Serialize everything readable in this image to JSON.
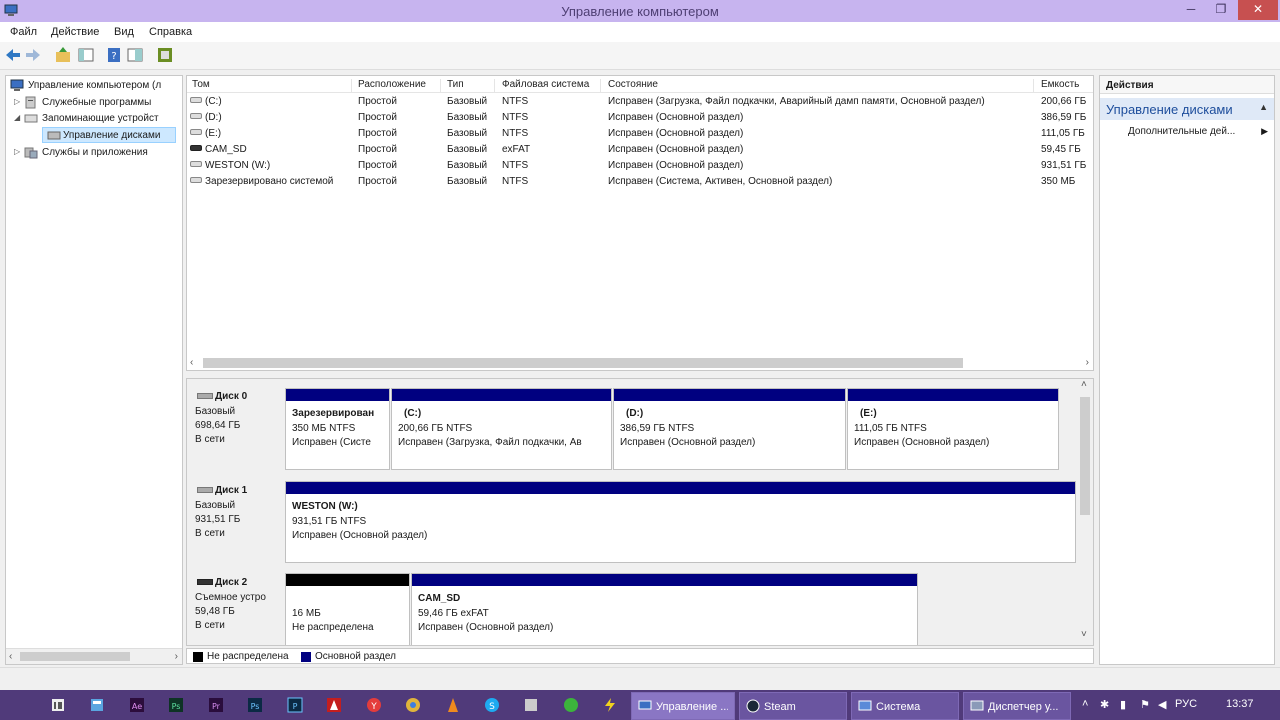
{
  "window": {
    "title": "Управление компьютером",
    "min_glyph": "─",
    "max_glyph": "❐",
    "close_glyph": "✕"
  },
  "menu": [
    "Файл",
    "Действие",
    "Вид",
    "Справка"
  ],
  "toolbar_icons": [
    "back-icon",
    "forward-icon",
    "up-folder-icon",
    "show-hide-tree-icon",
    "help-icon",
    "properties-icon",
    "console-icon"
  ],
  "tree": {
    "items": [
      {
        "label": "Управление компьютером (л",
        "expander": "",
        "icon": "computer-icon"
      },
      {
        "label": "Служебные программы",
        "expander": "▷",
        "icon": "tools-icon"
      },
      {
        "label": "Запоминающие устройст",
        "expander": "◢",
        "icon": "storage-icon"
      },
      {
        "label": "Управление дисками",
        "expander": "",
        "icon": "disk-management-icon"
      },
      {
        "label": "Службы и приложения",
        "expander": "▷",
        "icon": "services-icon"
      }
    ]
  },
  "volumes": {
    "columns": [
      "Том",
      "Расположение",
      "Тип",
      "Файловая система",
      "Состояние",
      "Емкость"
    ],
    "rows": [
      {
        "name": "(C:)",
        "layout": "Простой",
        "type": "Базовый",
        "fs": "NTFS",
        "status": "Исправен (Загрузка, Файл подкачки, Аварийный дамп памяти, Основной раздел)",
        "capacity": "200,66 ГБ",
        "icon": "drive-icon"
      },
      {
        "name": "(D:)",
        "layout": "Простой",
        "type": "Базовый",
        "fs": "NTFS",
        "status": "Исправен (Основной раздел)",
        "capacity": "386,59 ГБ",
        "icon": "drive-icon"
      },
      {
        "name": "(E:)",
        "layout": "Простой",
        "type": "Базовый",
        "fs": "NTFS",
        "status": "Исправен (Основной раздел)",
        "capacity": "111,05 ГБ",
        "icon": "drive-icon"
      },
      {
        "name": "CAM_SD",
        "layout": "Простой",
        "type": "Базовый",
        "fs": "exFAT",
        "status": "Исправен (Основной раздел)",
        "capacity": "59,45 ГБ",
        "icon": "sd-card-icon"
      },
      {
        "name": "WESTON (W:)",
        "layout": "Простой",
        "type": "Базовый",
        "fs": "NTFS",
        "status": "Исправен (Основной раздел)",
        "capacity": "931,51 ГБ",
        "icon": "drive-icon"
      },
      {
        "name": "Зарезервировано системой",
        "layout": "Простой",
        "type": "Базовый",
        "fs": "NTFS",
        "status": "Исправен (Система, Активен, Основной раздел)",
        "capacity": "350 МБ",
        "icon": "drive-icon"
      }
    ]
  },
  "disks": [
    {
      "name": "Диск 0",
      "kind": "Базовый",
      "size": "698,64 ГБ",
      "state": "В сети",
      "partitions": [
        {
          "title": "Зарезервирован",
          "size": "350 МБ NTFS",
          "status": "Исправен (Систе"
        },
        {
          "title": "(C:)",
          "size": "200,66 ГБ NTFS",
          "status": "Исправен (Загрузка, Файл подкачки, Ав"
        },
        {
          "title": "(D:)",
          "size": "386,59 ГБ NTFS",
          "status": "Исправен (Основной раздел)"
        },
        {
          "title": "(E:)",
          "size": "111,05 ГБ NTFS",
          "status": "Исправен (Основной раздел)"
        }
      ]
    },
    {
      "name": "Диск 1",
      "kind": "Базовый",
      "size": "931,51 ГБ",
      "state": "В сети",
      "partitions": [
        {
          "title": "WESTON  (W:)",
          "size": "931,51 ГБ NTFS",
          "status": "Исправен (Основной раздел)"
        }
      ]
    },
    {
      "name": "Диск 2",
      "kind": "Съемное устро",
      "size": "59,48 ГБ",
      "state": "В сети",
      "partitions": [
        {
          "title": "",
          "size": "16 МБ",
          "status": "Не распределена"
        },
        {
          "title": "CAM_SD",
          "size": "59,46 ГБ exFAT",
          "status": "Исправен (Основной раздел)"
        }
      ]
    }
  ],
  "legend": [
    {
      "label": "Не распределена",
      "color": "#000000"
    },
    {
      "label": "Основной раздел",
      "color": "#000080"
    }
  ],
  "actions": {
    "header": "Действия",
    "section": "Управление дисками",
    "section_caret": "▲",
    "more": "Дополнительные дей...",
    "more_arrow": "▶"
  },
  "taskbar": {
    "pinned_icons": [
      "file-manager-icon",
      "calculator-icon",
      "adobe-icon",
      "app-green-icon",
      "photoshop-icon",
      "photoshop-icon-2",
      "premiere-icon",
      "app-icon",
      "acrobat-icon",
      "yandex-icon",
      "chrome-icon",
      "vlc-icon",
      "skype-icon",
      "whatsapp-icon",
      "lightning-icon"
    ],
    "tasks": [
      {
        "label": "Управление ...",
        "active": true,
        "icon": "computer-management-icon"
      },
      {
        "label": "Steam",
        "active": false,
        "icon": "steam-icon"
      },
      {
        "label": "Система",
        "active": false,
        "icon": "system-icon"
      },
      {
        "label": "Диспетчер у...",
        "active": false,
        "icon": "device-manager-icon"
      }
    ],
    "lang": "РУС",
    "time": "13:37"
  },
  "colors": {
    "titlebar": "#c7b4ef",
    "primary_partition": "#000080",
    "unallocated": "#000000",
    "taskbar": "#503a7a",
    "actions_section": "#dfe9f7"
  }
}
